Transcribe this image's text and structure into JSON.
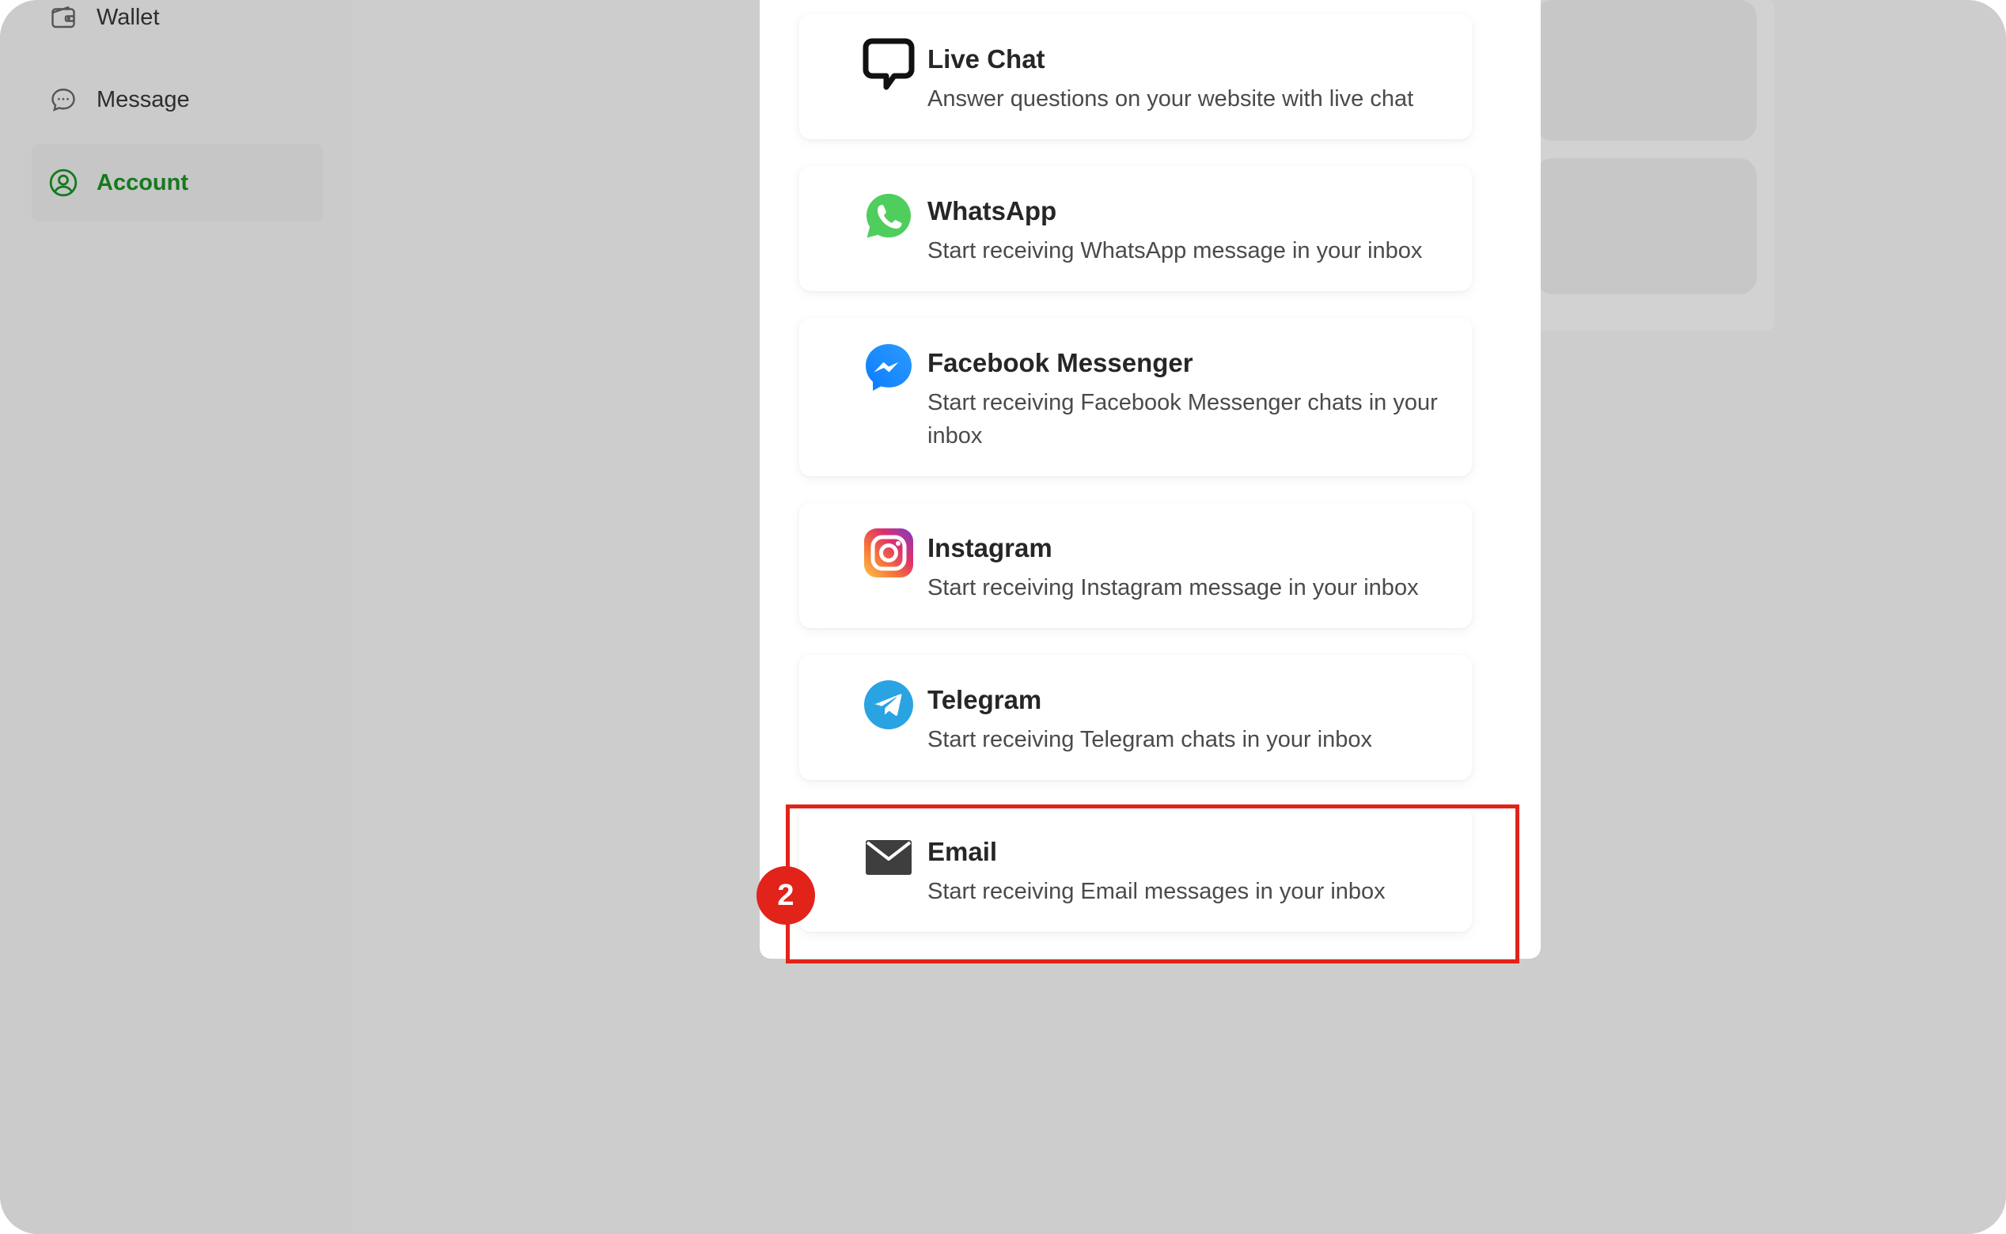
{
  "sidebar": {
    "items": [
      {
        "label": "Wallet",
        "icon": "wallet-icon",
        "active": false
      },
      {
        "label": "Message",
        "icon": "message-icon",
        "active": false
      },
      {
        "label": "Account",
        "icon": "account-icon",
        "active": true
      }
    ]
  },
  "channels": [
    {
      "title": "Live Chat",
      "description": "Answer questions on your website with live chat",
      "icon": "live-chat-icon"
    },
    {
      "title": "WhatsApp",
      "description": "Start receiving WhatsApp message in your inbox",
      "icon": "whatsapp-icon"
    },
    {
      "title": "Facebook Messenger",
      "description": "Start receiving Facebook Messenger chats in your inbox",
      "icon": "messenger-icon"
    },
    {
      "title": "Instagram",
      "description": "Start receiving Instagram message in your inbox",
      "icon": "instagram-icon"
    },
    {
      "title": "Telegram",
      "description": "Start receiving Telegram chats in your inbox",
      "icon": "telegram-icon"
    },
    {
      "title": "Email",
      "description": "Start receiving Email messages in your inbox",
      "icon": "email-icon"
    }
  ],
  "annotation": {
    "step": "2"
  },
  "colors": {
    "accent_green": "#157a1d",
    "highlight_red": "#e2231a",
    "whatsapp_green": "#4fce5d",
    "messenger_blue": "#0a7cff",
    "telegram_blue": "#2aa3e2"
  }
}
